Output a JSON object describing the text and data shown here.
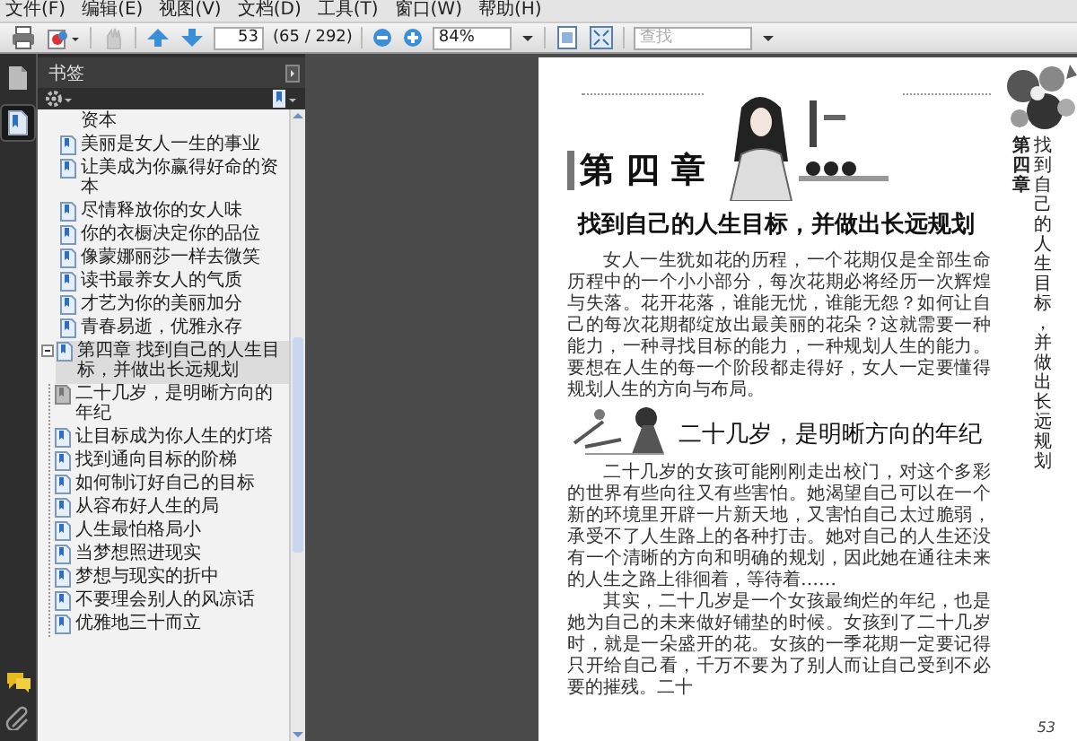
{
  "menu": [
    "文件(F)",
    "编辑(E)",
    "视图(V)",
    "文档(D)",
    "工具(T)",
    "窗口(W)",
    "帮助(H)"
  ],
  "toolbar": {
    "page_field": "53",
    "page_count": "(65 / 292)",
    "zoom": "84%",
    "search": {
      "placeholder": "查找"
    }
  },
  "side_tabs": [
    {
      "kind": "pages",
      "selected": false
    },
    {
      "kind": "bookmarks",
      "selected": true
    }
  ],
  "bookmarks_panel": {
    "title": "书签",
    "items": [
      {
        "kind": "continuation",
        "label": "资本",
        "selected": false
      },
      {
        "kind": "bookmark",
        "label": "美丽是女人一生的事业",
        "selected": false
      },
      {
        "kind": "bookmark",
        "label": "让美成为你赢得好命的资本",
        "selected": false
      },
      {
        "kind": "bookmark",
        "label": "尽情释放你的女人味",
        "selected": false
      },
      {
        "kind": "bookmark",
        "label": "你的衣橱决定你的品位",
        "selected": false
      },
      {
        "kind": "bookmark",
        "label": "像蒙娜丽莎一样去微笑",
        "selected": false
      },
      {
        "kind": "bookmark",
        "label": "读书最养女人的气质",
        "selected": false
      },
      {
        "kind": "bookmark",
        "label": "才艺为你的美丽加分",
        "selected": false
      },
      {
        "kind": "bookmark",
        "label": "青春易逝，优雅永存",
        "selected": false
      },
      {
        "kind": "chapter",
        "label": "第四章 找到自己的人生目标，并做出长远规划",
        "selected": true,
        "expanded": true,
        "children": [
          {
            "kind": "current",
            "label": "二十几岁，是明晰方向的年纪",
            "selected": false
          },
          {
            "kind": "bookmark",
            "label": "让目标成为你人生的灯塔",
            "selected": false
          },
          {
            "kind": "bookmark",
            "label": "找到通向目标的阶梯",
            "selected": false
          },
          {
            "kind": "bookmark",
            "label": "如何制订好自己的目标",
            "selected": false
          },
          {
            "kind": "bookmark",
            "label": "从容布好人生的局",
            "selected": false
          },
          {
            "kind": "bookmark",
            "label": "人生最怕格局小",
            "selected": false
          },
          {
            "kind": "bookmark",
            "label": "当梦想照进现实",
            "selected": false
          },
          {
            "kind": "bookmark",
            "label": "梦想与现实的折中",
            "selected": false
          },
          {
            "kind": "bookmark",
            "label": "不要理会别人的风凉话",
            "selected": false
          },
          {
            "kind": "bookmark",
            "label": "优雅地三十而立",
            "selected": false
          }
        ]
      }
    ]
  },
  "page": {
    "chapter_label": "第 四 章",
    "title": "找到自己的人生目标，并做出长远规划",
    "side_chapter": "第四章",
    "side_title": "找到自己的人生目标，并做出长远规划",
    "intro": [
      "女人一生犹如花的历程，一个花期仅是全部生命历程中的一个小小部分，每次花期必将经历一次辉煌与失落。花开花落，谁能无忧，谁能无怨？如何让自己的每次花期都绽放出最美丽的花朵？这就需要一种能力，一种寻找目标的能力，一种规划人生的能力。要想在人生的每一个阶段都走得好，女人一定要懂得规划人生的方向与布局。"
    ],
    "section": {
      "heading": "二十几岁，是明晰方向的年纪",
      "paragraphs": [
        "二十几岁的女孩可能刚刚走出校门，对这个多彩的世界有些向往又有些害怕。她渴望自己可以在一个新的环境里开辟一片新天地，又害怕自己太过脆弱，承受不了人生路上的各种打击。她对自己的人生还没有一个清晰的方向和明确的规划，因此她在通往未来的人生之路上徘徊着，等待着……",
        "其实，二十几岁是一个女孩最绚烂的年纪，也是她为自己的未来做好铺垫的时候。女孩到了二十几岁时，就是一朵盛开的花。女孩的一季花期一定要记得只开给自己看，千万不要为了别人而让自己受到不必要的摧残。二十"
      ]
    },
    "page_number": "53"
  }
}
